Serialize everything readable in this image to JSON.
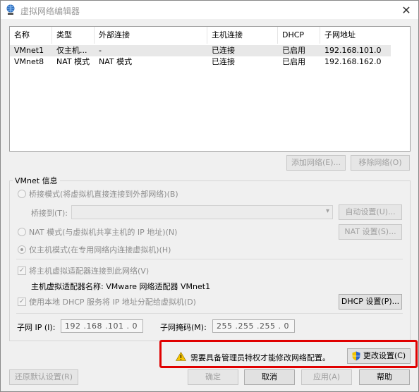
{
  "window": {
    "title": "虚拟网络编辑器",
    "close_glyph": "✕"
  },
  "list": {
    "columns": [
      "名称",
      "类型",
      "外部连接",
      "主机连接",
      "DHCP",
      "子网地址"
    ],
    "rows": [
      {
        "name": "VMnet1",
        "type": "仅主机...",
        "external": "-",
        "host": "已连接",
        "dhcp": "已启用",
        "subnet": "192.168.101.0"
      },
      {
        "name": "VMnet8",
        "type": "NAT 模式",
        "external": "NAT 模式",
        "host": "已连接",
        "dhcp": "已启用",
        "subnet": "192.168.162.0"
      }
    ],
    "selected_row": 0
  },
  "list_buttons": {
    "add": "添加网络(E)...",
    "remove": "移除网络(O)"
  },
  "vmnet_info": {
    "title": "VMnet 信息",
    "bridged_label": "桥接模式(将虚拟机直接连接到外部网络)(B)",
    "bridge_to_label": "桥接到(T):",
    "bridge_to_value": "",
    "auto_settings": "自动设置(U)...",
    "nat_label": "NAT 模式(与虚拟机共享主机的 IP 地址)(N)",
    "nat_settings": "NAT 设置(S)...",
    "hostonly_label": "仅主机模式(在专用网络内连接虚拟机)(H)",
    "connect_adapter_label": "将主机虚拟适配器连接到此网络(V)",
    "adapter_name_label": "主机虚拟适配器名称: VMware 网络适配器 VMnet1",
    "use_dhcp_label": "使用本地 DHCP 服务将 IP 地址分配给虚拟机(D)",
    "dhcp_settings": "DHCP 设置(P)...",
    "subnet_ip_label": "子网 IP (I):",
    "subnet_ip_value": "192 .168 .101 . 0",
    "subnet_mask_label": "子网掩码(M):",
    "subnet_mask_value": "255 .255 .255 . 0",
    "selected_mode": "hostonly",
    "connect_adapter_checked": true,
    "use_dhcp_checked": true
  },
  "warning": {
    "text": "需要具备管理员特权才能修改网络配置。",
    "change_settings": "更改设置(C)"
  },
  "footer": {
    "restore_defaults": "还原默认设置(R)",
    "ok": "确定",
    "cancel": "取消",
    "apply": "应用(A)",
    "help": "帮助"
  },
  "colors": {
    "highlight_frame": "#e00000",
    "window_bg": "#f0f0f0",
    "disabled_text": "#a0a0a0"
  }
}
